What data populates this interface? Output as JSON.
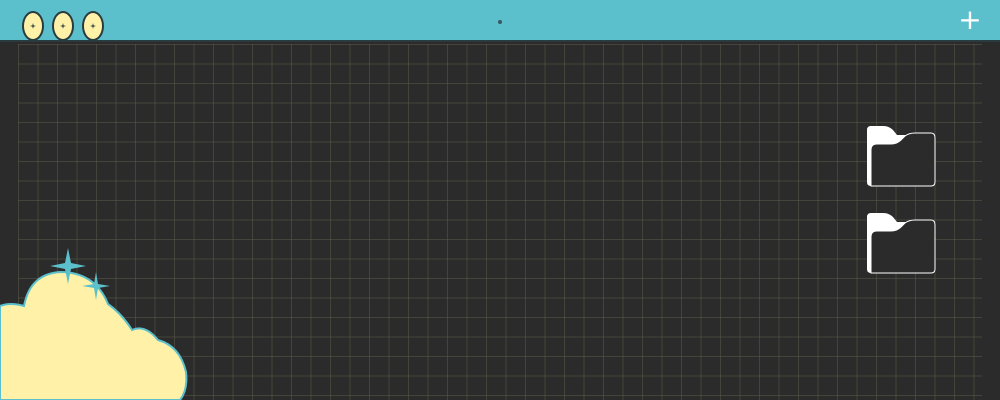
{
  "window": {
    "controls": [
      {
        "icon": "sparkle-icon"
      },
      {
        "icon": "sparkle-icon"
      },
      {
        "icon": "sparkle-icon"
      }
    ],
    "plus_label": "+"
  },
  "desktop": {
    "folders": [
      {
        "icon": "folder-icon"
      },
      {
        "icon": "folder-icon"
      }
    ]
  },
  "colors": {
    "topbar": "#5bc0cc",
    "background": "#2b2b2b",
    "cloud": "#fff2a8",
    "accent": "#5bc0cc"
  }
}
